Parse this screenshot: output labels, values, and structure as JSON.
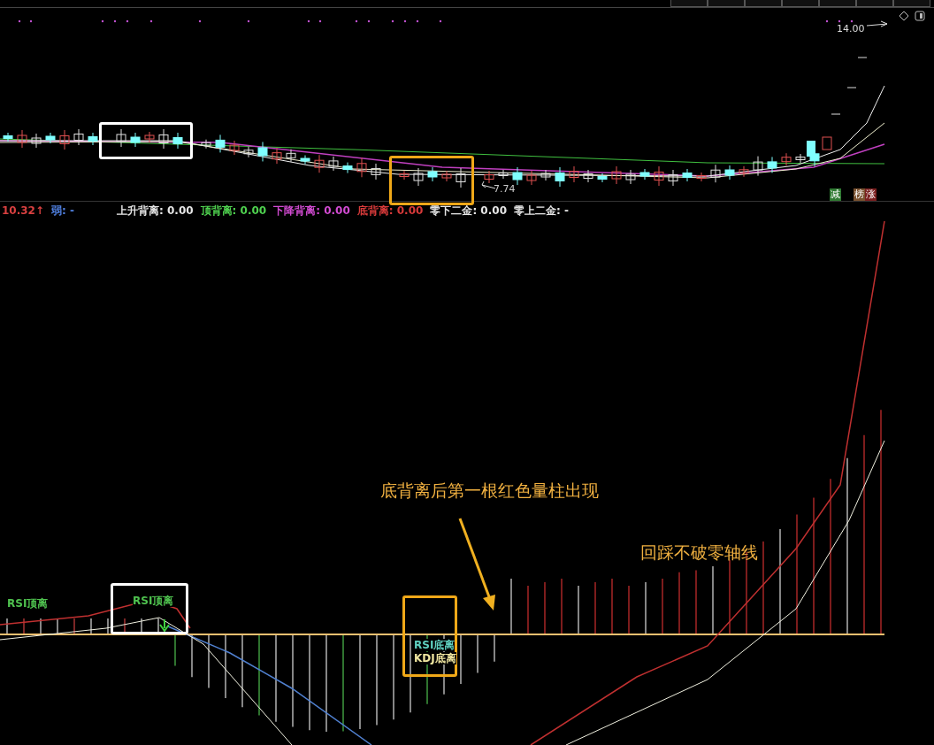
{
  "price_panel": {
    "high_label": "14.00",
    "low_label": "7.74",
    "tags": [
      {
        "label": "减",
        "color": "#2f7a32"
      },
      {
        "label": "榜",
        "color": "#7a5230"
      },
      {
        "label": "涨",
        "color": "#7a1f1f"
      }
    ]
  },
  "indicator_legend": {
    "value": "10.32↑",
    "strength_label": "弱:",
    "strength_value": "-",
    "items": [
      {
        "label": "上升背离:",
        "value": "0.00",
        "color": "#e6e6e6"
      },
      {
        "label": "顶背离:",
        "value": "0.00",
        "color": "#4fd14f"
      },
      {
        "label": "下降背离:",
        "value": "0.00",
        "color": "#d24bd2"
      },
      {
        "label": "底背离:",
        "value": "0.00",
        "color": "#d83a3a"
      },
      {
        "label": "零下二金:",
        "value": "0.00",
        "color": "#e6e6e6"
      },
      {
        "label": "零上二金:",
        "value": "-",
        "color": "#e6e6e6"
      }
    ]
  },
  "indicator_panel": {
    "signals": [
      {
        "text": "RSI顶离",
        "color": "#4fc24f"
      },
      {
        "text": "RSI顶离",
        "color": "#4fc24f"
      },
      {
        "text": "RSI底离",
        "color": "#5fd0c0"
      },
      {
        "text": "KDJ底离",
        "color": "#f0e6a0"
      }
    ],
    "annotations": [
      {
        "text": "底背离后第一根红色量柱出现"
      },
      {
        "text": "回踩不破零轴线"
      }
    ]
  }
}
